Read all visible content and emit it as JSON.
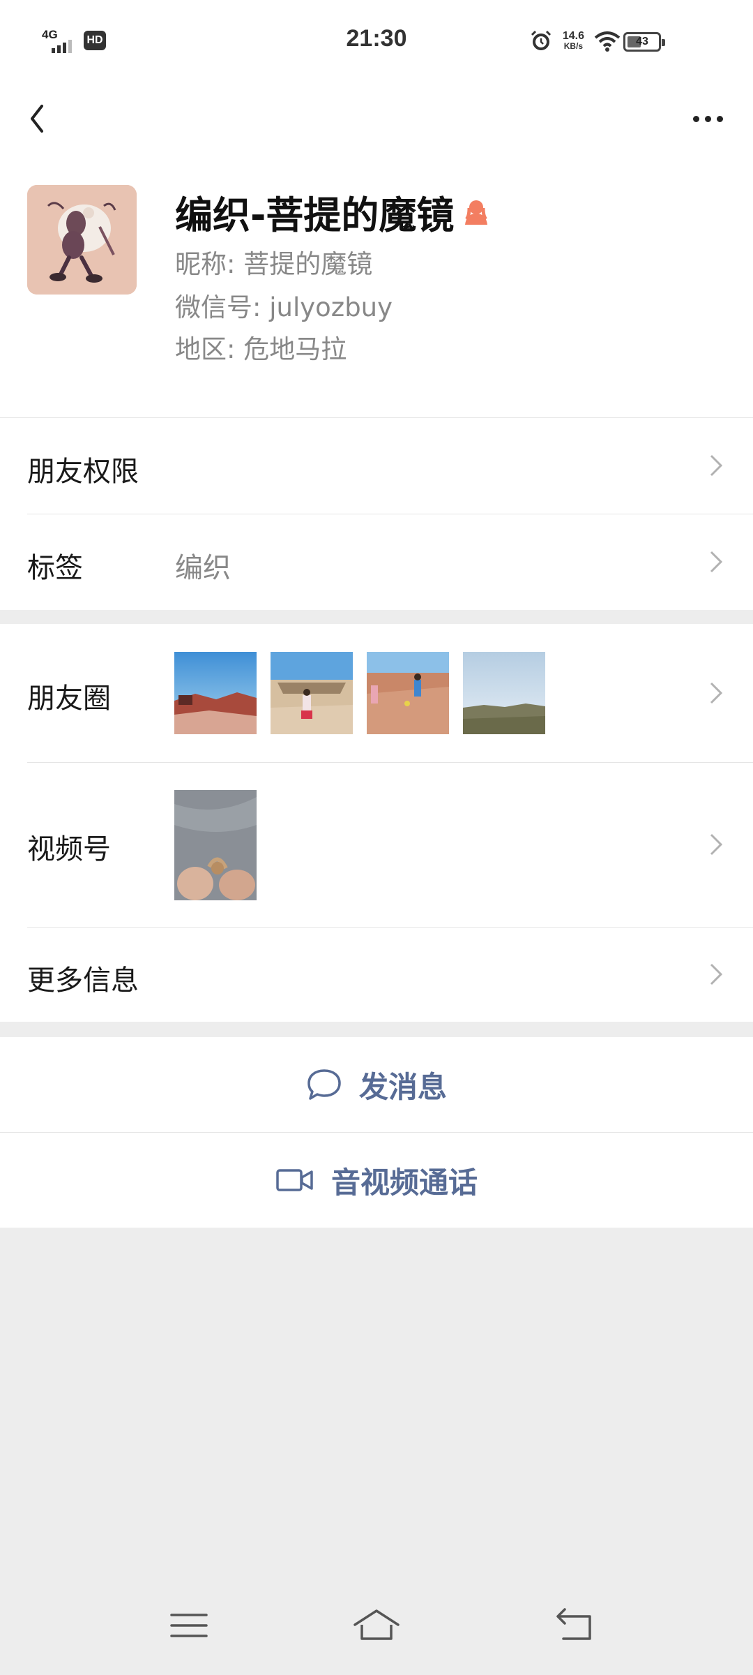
{
  "status_bar": {
    "network": "4G",
    "hd": "HD",
    "time": "21:30",
    "speed_value": "14.6",
    "speed_unit": "KB/s",
    "battery": "43"
  },
  "profile": {
    "remark_name": "编织-菩提的魔镜",
    "nickname_label": "昵称:",
    "nickname": "菩提的魔镜",
    "wechat_id_label": "微信号:",
    "wechat_id": "julyozbuy",
    "region_label": "地区:",
    "region": "危地马拉",
    "gender_icon": "female-icon"
  },
  "rows": {
    "permissions": "朋友权限",
    "tags_label": "标签",
    "tags_value": "编织",
    "moments": "朋友圈",
    "channels": "视频号",
    "more_info": "更多信息"
  },
  "actions": {
    "message": "发消息",
    "call": "音视频通话"
  },
  "colors": {
    "link_blue": "#576b95",
    "female_icon": "#f37e61",
    "background": "#ededed"
  }
}
